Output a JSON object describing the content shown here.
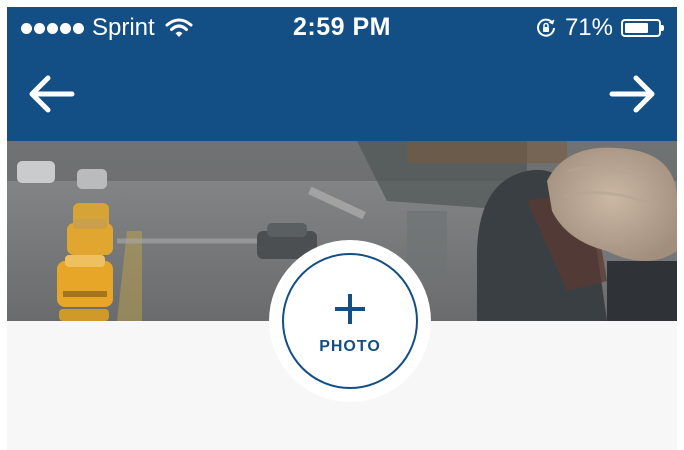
{
  "status_bar": {
    "carrier": "Sprint",
    "signal_dots": 5,
    "wifi_icon": "wifi-icon",
    "time": "2:59 PM",
    "rotation_lock_icon": "rotation-lock-icon",
    "battery_percent": "71%",
    "battery_level": 0.71
  },
  "nav": {
    "back_icon": "arrow-left-icon",
    "forward_icon": "arrow-right-icon"
  },
  "cover": {
    "image": "city-street-cover-photo"
  },
  "photo_button": {
    "icon": "plus-icon",
    "label": "PHOTO"
  },
  "colors": {
    "header_blue": "#134f84",
    "background": "#f7f7f7"
  }
}
